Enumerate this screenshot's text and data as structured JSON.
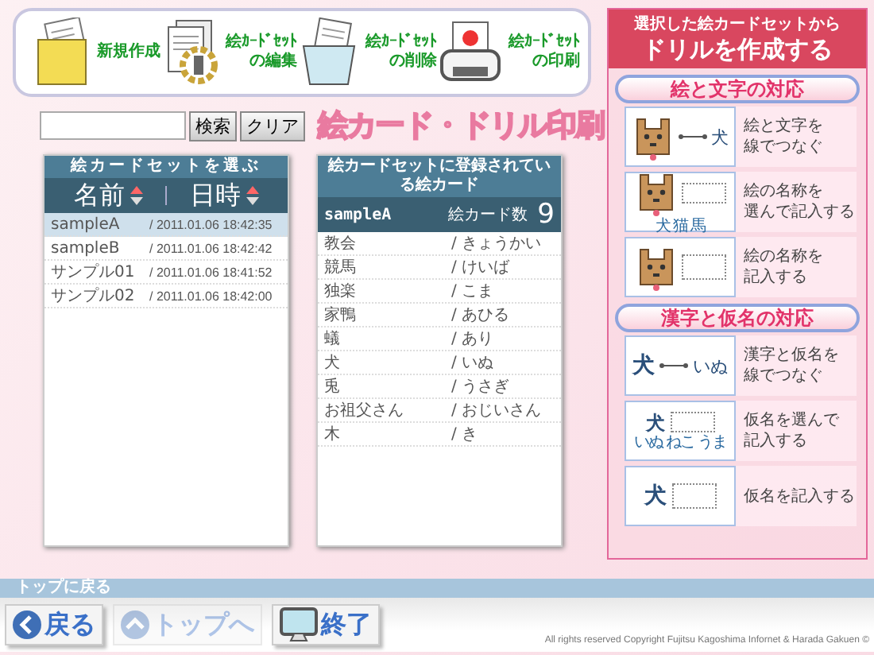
{
  "toolbar": {
    "tools": [
      {
        "kind": "new",
        "label_lines": [
          "新規作成"
        ]
      },
      {
        "kind": "edit",
        "label_lines": [
          "絵ｶｰﾄﾞｾｯﾄ",
          "の編集"
        ]
      },
      {
        "kind": "delete",
        "label_lines": [
          "絵ｶｰﾄﾞｾｯﾄ",
          "の削除"
        ]
      },
      {
        "kind": "print",
        "label_lines": [
          "絵ｶｰﾄﾞｾｯﾄ",
          "の印刷"
        ]
      }
    ]
  },
  "search": {
    "buttons": [
      "検索",
      "クリア"
    ]
  },
  "app_title": "絵カード・ドリル印刷",
  "set_list": {
    "title": "絵カードセットを選ぶ",
    "columns": [
      "名前",
      "日時"
    ],
    "rows": [
      {
        "name": "sampleA",
        "date": "/ 2011.01.06 18:42:35",
        "selected": true
      },
      {
        "name": "sampleB",
        "date": "/ 2011.01.06 18:42:42",
        "selected": false
      },
      {
        "name": "サンプル01",
        "date": "/ 2011.01.06 18:41:52",
        "selected": false
      },
      {
        "name": "サンプル02",
        "date": "/ 2011.01.06 18:42:00",
        "selected": false
      }
    ]
  },
  "card_list": {
    "title": "絵カードセットに登録されている絵カード",
    "set_name": "sampleA",
    "count_label": "絵カード数",
    "count": "9",
    "rows": [
      {
        "word": "教会",
        "reading": "/ きょうかい"
      },
      {
        "word": "競馬",
        "reading": "/ けいば"
      },
      {
        "word": "独楽",
        "reading": "/ こま"
      },
      {
        "word": "家鴨",
        "reading": "/ あひる"
      },
      {
        "word": "蟻",
        "reading": "/ あり"
      },
      {
        "word": "犬",
        "reading": "/ いぬ"
      },
      {
        "word": "兎",
        "reading": "/ うさぎ"
      },
      {
        "word": "お祖父さん",
        "reading": "/ おじいさん"
      },
      {
        "word": "木",
        "reading": "/ き"
      }
    ]
  },
  "drill": {
    "subtitle": "選択した絵カードセットから",
    "title": "ドリルを作成する",
    "sections": [
      {
        "title": "絵と文字の対応",
        "items": [
          {
            "kind": "line",
            "target": "犬",
            "label_lines": [
              "絵と文字を",
              "線でつなぐ"
            ]
          },
          {
            "kind": "choose",
            "choices": [
              "犬",
              "猫",
              "馬"
            ],
            "label_lines": [
              "絵の名称を",
              "選んで記入する"
            ]
          },
          {
            "kind": "write",
            "label_lines": [
              "絵の名称を",
              "記入する"
            ]
          }
        ]
      },
      {
        "title": "漢字と仮名の対応",
        "items": [
          {
            "kind": "line",
            "prompt": "犬",
            "target": "いぬ",
            "label_lines": [
              "漢字と仮名を",
              "線でつなぐ"
            ]
          },
          {
            "kind": "choose",
            "prompt": "犬",
            "choices": [
              "いぬ",
              "ねこ",
              "うま"
            ],
            "label_lines": [
              "仮名を選んで",
              "記入する"
            ]
          },
          {
            "kind": "write",
            "prompt": "犬",
            "label_lines": [
              "仮名を記入する"
            ]
          }
        ]
      }
    ]
  },
  "footer": {
    "bar_label": "トップに戻る",
    "buttons": [
      {
        "kind": "back",
        "label": "戻る",
        "disabled": false
      },
      {
        "kind": "top",
        "label": "トップへ",
        "disabled": true
      },
      {
        "kind": "exit",
        "label": "終了",
        "disabled": false
      }
    ],
    "copyright": "All rights reserved Copyright Fujitsu Kagoshima Infornet & Harada Gakuen ©"
  }
}
